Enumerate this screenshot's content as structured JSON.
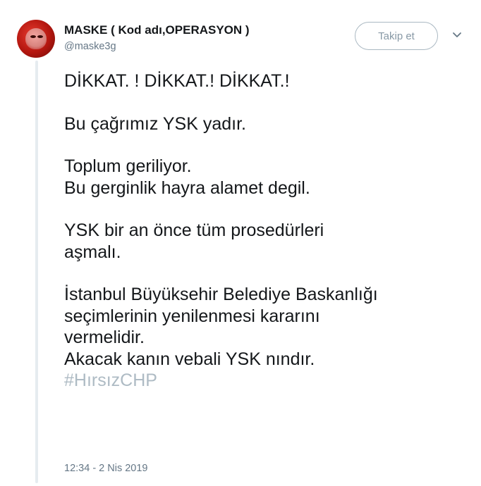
{
  "user": {
    "display_name": "MASKE ( Kod adı,OPERASYON )",
    "handle": "@maske3g"
  },
  "follow_button": {
    "label": "Takip et"
  },
  "menu": {
    "icon": "chevron-down-icon"
  },
  "tweet": {
    "paragraphs": [
      [
        "DİKKAT. ! DİKKAT.! DİKKAT.!"
      ],
      [
        "Bu çağrımız YSK yadır."
      ],
      [
        "Toplum geriliyor.",
        "Bu gerginlik hayra alamet degil."
      ],
      [
        "YSK bir an önce tüm prosedürleri",
        "aşmalı."
      ],
      [
        "İstanbul Büyüksehir Belediye Baskanlığı",
        "seçimlerinin yenilenmesi kararını",
        "vermelidir.",
        "Akacak kanın vebali YSK nındır."
      ]
    ],
    "hashtag": "#HırsızCHP",
    "timestamp": "12:34 - 2 Nis 2019"
  },
  "colors": {
    "text": "#14171a",
    "muted": "#657786",
    "hashtag": "#aebbc4",
    "border": "#aab8c2"
  }
}
